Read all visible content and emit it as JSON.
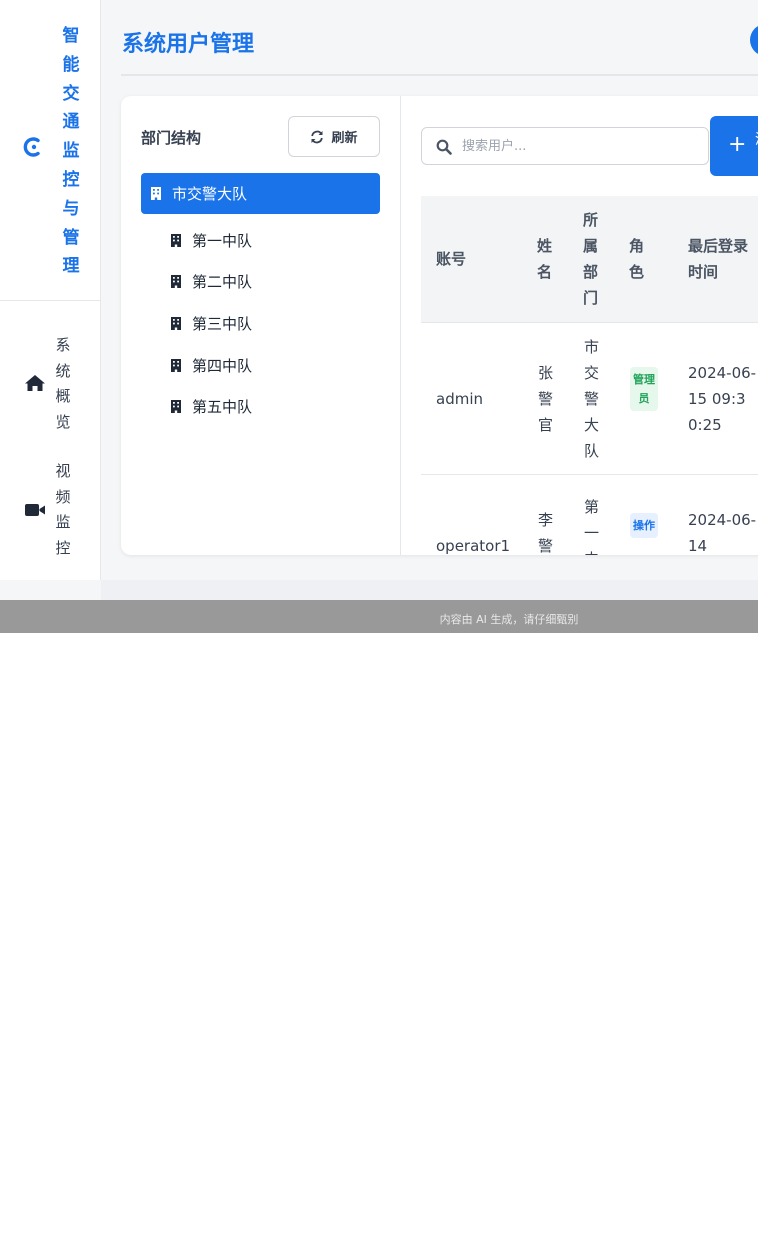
{
  "sidebar": {
    "brand": "智能交通监控与管理",
    "nav": [
      {
        "label": "系统概览",
        "icon": "home-icon"
      },
      {
        "label": "视频监控",
        "icon": "video-camera-icon"
      }
    ]
  },
  "header": {
    "title": "系统用户管理"
  },
  "departments": {
    "title": "部门结构",
    "refresh_label": "刷新",
    "root": "市交警大队",
    "children": [
      "第一中队",
      "第二中队",
      "第三中队",
      "第四中队",
      "第五中队"
    ]
  },
  "users": {
    "search_placeholder": "搜索用户...",
    "add_label": "添",
    "columns": [
      "账号",
      "姓名",
      "所属部门",
      "角色",
      "最后登录时间"
    ],
    "rows": [
      {
        "account": "admin",
        "name": "张警官",
        "department": "市交警大队",
        "role": "管理员",
        "last_login": "2024-06-15 09:30:25",
        "role_type": "admin"
      },
      {
        "account": "operator1",
        "name": "李警",
        "department": "第一中",
        "role": "操作",
        "last_login": "2024-06-14",
        "role_type": "op"
      }
    ]
  },
  "footer": {
    "disclaimer": "内容由 AI 生成，请仔细甄别"
  },
  "colors": {
    "accent": "#1a73e8",
    "admin_badge": "#22a35a",
    "operator_badge": "#1a73e8"
  }
}
